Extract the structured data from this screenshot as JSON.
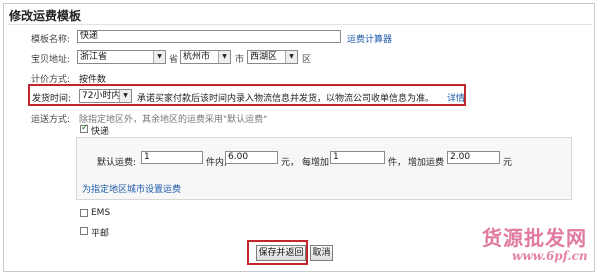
{
  "page_title": "修改运费模板",
  "form": {
    "template_name": {
      "label": "模板名称:",
      "value": "快递",
      "calc_link": "运费计算器"
    },
    "location": {
      "label": "宝贝地址:",
      "province": "浙江省",
      "province_suffix": "省",
      "city": "杭州市",
      "city_suffix": "市",
      "district": "西湖区",
      "district_suffix": "区"
    },
    "pricing": {
      "label": "计价方式:",
      "value": "按件数"
    },
    "ship_time": {
      "label": "发货时间:",
      "value": "72小时内",
      "note": "承诺买家付款后该时间内录入物流信息并发货，以物流公司收单信息为准。",
      "detail_link": "详情"
    },
    "shipping": {
      "label": "运送方式:",
      "hint": "除指定地区外，其余地区的运费采用\"默认运费\"",
      "express": {
        "label": "快递",
        "default_label": "默认运费:",
        "first_count": "1",
        "unit_piece": "件内,",
        "first_fee": "6.00",
        "yuan1": "元，",
        "each_add_label": "每增加",
        "add_count": "1",
        "unit_piece2": "件，",
        "add_fee_label": "增加运费",
        "add_fee": "2.00",
        "yuan2": "元",
        "region_link": "为指定地区城市设置运费"
      },
      "ems": "EMS",
      "mail": "平邮"
    },
    "buttons": {
      "save": "保存并返回",
      "cancel": "取消"
    }
  },
  "watermark": {
    "text": "货源批发网",
    "url": "www.6pf.cn"
  }
}
